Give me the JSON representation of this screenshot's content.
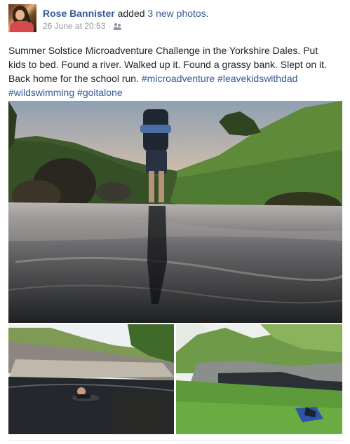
{
  "post": {
    "author": "Rose Bannister",
    "action": "added",
    "photo_count": "3 new photos",
    "period": ".",
    "timestamp": "26 June at 20:53",
    "separator": "·",
    "audience_icon": "friends-icon",
    "text_lines": [
      "Summer Solstice Microadventure Challenge in the Yorkshire Dales. Put",
      "kids to bed. Found a river. Walked up it. Found a grassy bank. Slept on it."
    ],
    "text_line3_plain": "Back home for the school run. ",
    "hashtags": [
      "#microadventure",
      "#leavekidswithdad",
      "#wildswimming",
      "#goitalone"
    ]
  },
  "colors": {
    "link": "#365899",
    "text": "#1d2129",
    "meta": "#90949c"
  }
}
